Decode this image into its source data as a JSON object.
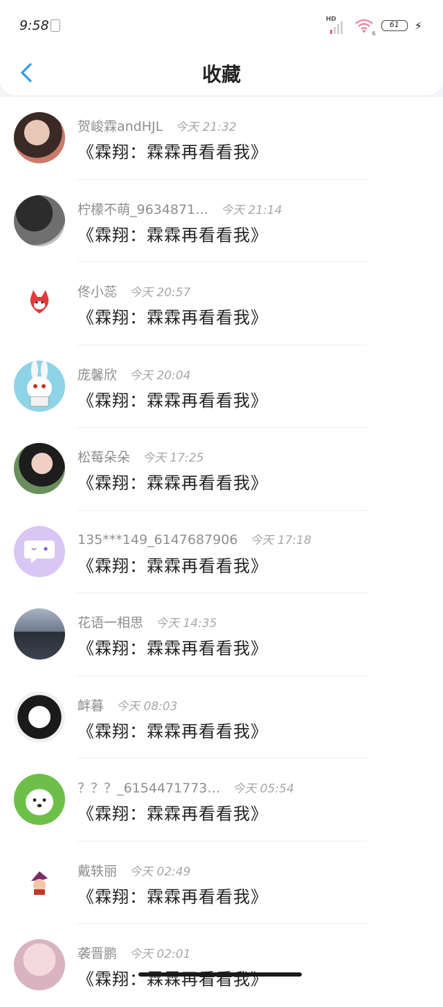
{
  "status_bar": {
    "time": "9:58",
    "network_label": "HD",
    "wifi_sub": "6",
    "battery": "61"
  },
  "header": {
    "back_icon": "chevron-left-icon",
    "title": "收藏"
  },
  "colors": {
    "accent": "#2b9cf2",
    "name_gray": "#8e8e8e",
    "time_gray": "#a8a8a8"
  },
  "favorites": [
    {
      "name": "贺峻霖andHJL",
      "time": "今天 21:32",
      "message": "《霖翔：霖霖再看看我》",
      "avatar": "photo-avatar"
    },
    {
      "name": "柠檬不萌_9634871…",
      "time": "今天 21:14",
      "message": "《霖翔：霖霖再看看我》",
      "avatar": "photo-avatar"
    },
    {
      "name": "佟小蕊",
      "time": "今天 20:57",
      "message": "《霖翔：霖霖再看看我》",
      "avatar": "cartoon-fox-avatar"
    },
    {
      "name": "庞馨欣",
      "time": "今天 20:04",
      "message": "《霖翔：霖霖再看看我》",
      "avatar": "rabbit-avatar"
    },
    {
      "name": "松莓朵朵",
      "time": "今天 17:25",
      "message": "《霖翔：霖霖再看看我》",
      "avatar": "photo-avatar"
    },
    {
      "name": "135***149_6147687906",
      "time": "今天 17:18",
      "message": "《霖翔：霖霖再看看我》",
      "avatar": "default-chat-avatar"
    },
    {
      "name": "花语一相思",
      "time": "今天 14:35",
      "message": "《霖翔：霖霖再看看我》",
      "avatar": "photo-avatar"
    },
    {
      "name": "衅暮",
      "time": "今天 08:03",
      "message": "《霖翔：霖霖再看看我》",
      "avatar": "anime-avatar"
    },
    {
      "name": "？？？_6154471773…",
      "time": "今天 05:54",
      "message": "《霖翔：霖霖再看看我》",
      "avatar": "dog-avatar"
    },
    {
      "name": "戴轶丽",
      "time": "今天 02:49",
      "message": "《霖翔：霖霖再看看我》",
      "avatar": "cartoon-avatar"
    },
    {
      "name": "袭晋鹏",
      "time": "今天 02:01",
      "message": "《霖翔：霖霖再看看我》",
      "avatar": "photo-avatar"
    }
  ]
}
